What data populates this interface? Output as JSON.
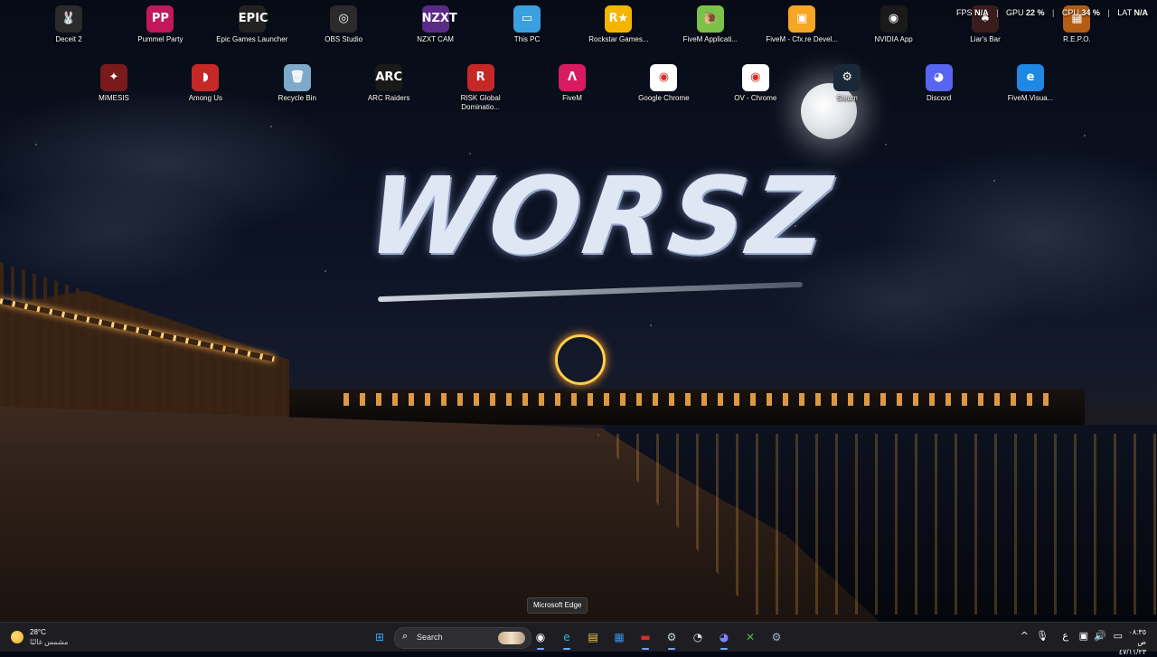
{
  "desktop": {
    "icons_row1": [
      {
        "label": "Deceit 2",
        "icon": "rabbit-icon",
        "color": "#2a2a2a",
        "glyph": "🐰"
      },
      {
        "label": "Pummel Party",
        "icon": "pummel-party-icon",
        "color": "#c2185b",
        "glyph": "PP"
      },
      {
        "label": "Epic Games Launcher",
        "icon": "epic-games-icon",
        "color": "#222222",
        "glyph": "EPIC"
      },
      {
        "label": "OBS Studio",
        "icon": "obs-icon",
        "color": "#2b2b2b",
        "glyph": "◎"
      },
      {
        "label": "NZXT CAM",
        "icon": "nzxt-icon",
        "color": "#5b2a86",
        "glyph": "NZXT"
      },
      {
        "label": "This PC",
        "icon": "monitor-icon",
        "color": "#3aa0e0",
        "glyph": "▭"
      },
      {
        "label": "Rockstar Games...",
        "icon": "rockstar-icon",
        "color": "#f4b400",
        "glyph": "R★"
      },
      {
        "label": "FiveM Applicati...",
        "icon": "fivem-snail-icon",
        "color": "#7cc24a",
        "glyph": "🐌"
      },
      {
        "label": "FiveM - Cfx.re Devel...",
        "icon": "cfx-box-icon",
        "color": "#f5a623",
        "glyph": "▣"
      },
      {
        "label": "NVIDIA App",
        "icon": "nvidia-icon",
        "color": "#1a1a1a",
        "glyph": "◉"
      },
      {
        "label": "Liar's Bar",
        "icon": "liars-bar-icon",
        "color": "#3b1c1c",
        "glyph": "♠"
      },
      {
        "label": "R.E.P.O.",
        "icon": "repo-icon",
        "color": "#b35c14",
        "glyph": "▦"
      }
    ],
    "icons_row2": [
      {
        "label": "MIMESIS",
        "icon": "mimesis-icon",
        "color": "#7a1a1a",
        "glyph": "✦"
      },
      {
        "label": "Among Us",
        "icon": "among-us-icon",
        "color": "#c62828",
        "glyph": "◗"
      },
      {
        "label": "Recycle Bin",
        "icon": "recycle-bin-icon",
        "color": "#7fa9c9",
        "glyph": "🗑"
      },
      {
        "label": "ARC Raiders",
        "icon": "arc-raiders-icon",
        "color": "#1a1a1a",
        "glyph": "ARC"
      },
      {
        "label": "RISK Global Dominatio...",
        "icon": "risk-icon",
        "color": "#c62828",
        "glyph": "R"
      },
      {
        "label": "FiveM",
        "icon": "fivem-icon",
        "color": "#d81b60",
        "glyph": "Λ"
      },
      {
        "label": "Google Chrome",
        "icon": "chrome-icon",
        "color": "#ffffff",
        "glyph": "◉"
      },
      {
        "label": "OV - Chrome",
        "icon": "chrome-ov-icon",
        "color": "#ffffff",
        "glyph": "◉"
      },
      {
        "label": "Steam",
        "icon": "steam-icon",
        "color": "#1b2838",
        "glyph": "⚙"
      },
      {
        "label": "Discord",
        "icon": "discord-icon",
        "color": "#5865f2",
        "glyph": "◕"
      },
      {
        "label": "FiveM.Visua...",
        "icon": "edge-icon",
        "color": "#1e88e5",
        "glyph": "e"
      }
    ]
  },
  "wallpaper": {
    "title": "WORSZ"
  },
  "overlay": {
    "fps_label": "FPS",
    "fps_value": "N/A",
    "gpu_label": "GPU",
    "gpu_value": "22 %",
    "cpu_label": "CPU",
    "cpu_value": "34 %",
    "lat_label": "LAT",
    "lat_value": "N/A"
  },
  "tooltip": {
    "text": "Microsoft Edge"
  },
  "taskbar": {
    "weather": {
      "temp": "28°C",
      "condition": "مشمس غالبًا",
      "icon": "sun-icon"
    },
    "search_placeholder": "Search",
    "apps": [
      {
        "name": "start-button",
        "glyph": "⊞",
        "color": "#3aa0ff",
        "active": false
      },
      {
        "name": "taskbar-chrome",
        "glyph": "◉",
        "color": "#ffffff",
        "active": true
      },
      {
        "name": "taskbar-edge",
        "glyph": "e",
        "color": "#2bb6e0",
        "active": true
      },
      {
        "name": "taskbar-file-explorer",
        "glyph": "▤",
        "color": "#f2c84b",
        "active": false
      },
      {
        "name": "taskbar-store",
        "glyph": "▦",
        "color": "#3a8ee6",
        "active": false
      },
      {
        "name": "taskbar-app-red",
        "glyph": "▬",
        "color": "#d32f2f",
        "active": true
      },
      {
        "name": "taskbar-steam",
        "glyph": "⚙",
        "color": "#c6d4df",
        "active": true
      },
      {
        "name": "taskbar-app-clock",
        "glyph": "◔",
        "color": "#e0e0e0",
        "active": false
      },
      {
        "name": "taskbar-discord",
        "glyph": "◕",
        "color": "#7b86ff",
        "active": true
      },
      {
        "name": "taskbar-xbox",
        "glyph": "✕",
        "color": "#52b043",
        "active": false
      },
      {
        "name": "taskbar-settings",
        "glyph": "⚙",
        "color": "#9bb4c9",
        "active": false
      }
    ],
    "tray": {
      "chevron": "^",
      "mic": "🎙",
      "lang": "ع",
      "network": "▣",
      "volume": "🔊",
      "battery": "▭"
    },
    "clock": {
      "time": "٠٨:٣٥ ص",
      "date": "٤٧/١١/٢٣"
    }
  }
}
